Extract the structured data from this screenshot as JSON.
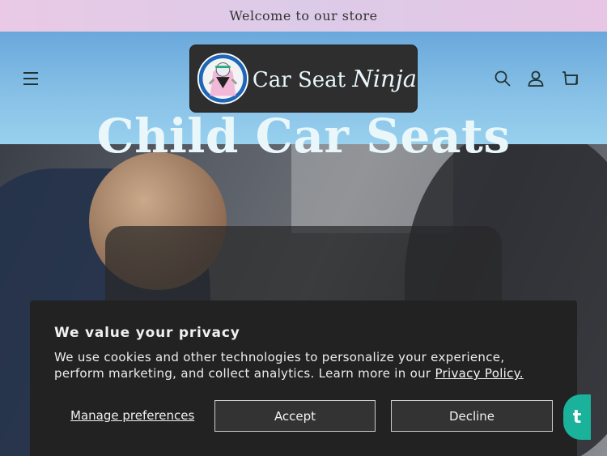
{
  "announcement": {
    "text": "Welcome to our store"
  },
  "header": {
    "logo": {
      "text_main": "Car Seat",
      "text_accent": "Ninja"
    },
    "icons": [
      "menu-icon",
      "search-icon",
      "account-icon",
      "cart-icon"
    ]
  },
  "hero": {
    "title": "Child Car Seats"
  },
  "cookie_banner": {
    "title": "We value your privacy",
    "text": "We use cookies and other technologies to personalize your experience, perform marketing, and collect analytics. Learn more in our ",
    "policy_link": "Privacy Policy.",
    "manage_label": "Manage preferences",
    "accept_label": "Accept",
    "decline_label": "Decline"
  },
  "chat_widget": {
    "label": "t"
  },
  "colors": {
    "announcement_bg": "#e2c9e7",
    "header_bg": "#7eb8e2",
    "logo_bg": "#2e2e2e",
    "banner_bg": "#222222",
    "chat_bg": "#1bb29c"
  }
}
